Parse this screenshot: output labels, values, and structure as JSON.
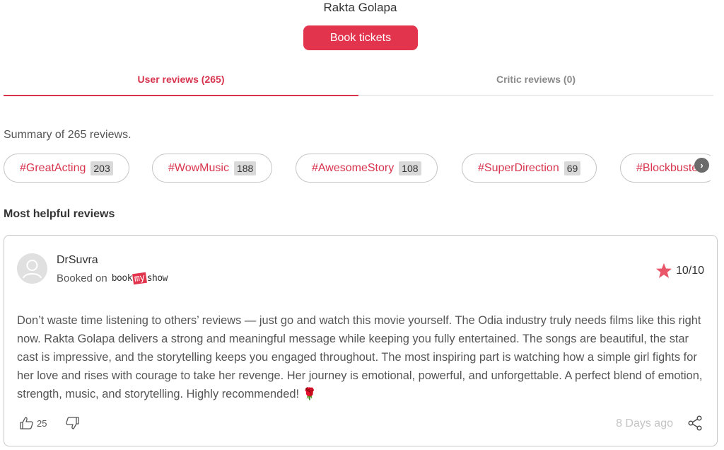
{
  "movie": {
    "title": "Rakta Golapa",
    "book_label": "Book tickets"
  },
  "tabs": [
    {
      "label": "User reviews (265)"
    },
    {
      "label": "Critic reviews (0)"
    }
  ],
  "summary": "Summary of 265 reviews.",
  "tags": [
    {
      "tag": "#GreatActing",
      "count": "203"
    },
    {
      "tag": "#WowMusic",
      "count": "188"
    },
    {
      "tag": "#AwesomeStory",
      "count": "108"
    },
    {
      "tag": "#SuperDirection",
      "count": "69"
    },
    {
      "tag": "#Blockbuster",
      "count": ""
    }
  ],
  "section_title": "Most helpful reviews",
  "review": {
    "author": "DrSuvra",
    "booked_on": "Booked on",
    "logo": {
      "book": "book",
      "my": "my",
      "show": "show"
    },
    "rating": "10/10",
    "text": "Don’t waste time listening to others’ reviews — just go and watch this movie yourself. The Odia industry truly needs films like this right now. Rakta Golapa delivers a strong and meaningful message while keeping you fully entertained. The songs are beautiful, the star cast is impressive, and the storytelling keeps you engaged throughout. The most inspiring part is watching how a simple girl fights for her love and rises with courage to take her revenge. Her journey is emotional, powerful, and unforgettable. A perfect blend of emotion, strength, music, and storytelling. Highly recommended! 🌹",
    "likes": "25",
    "time": "8 Days ago"
  },
  "colors": {
    "accent": "#e2344d",
    "tag_text": "#d8344e",
    "star": "#e9566a"
  }
}
